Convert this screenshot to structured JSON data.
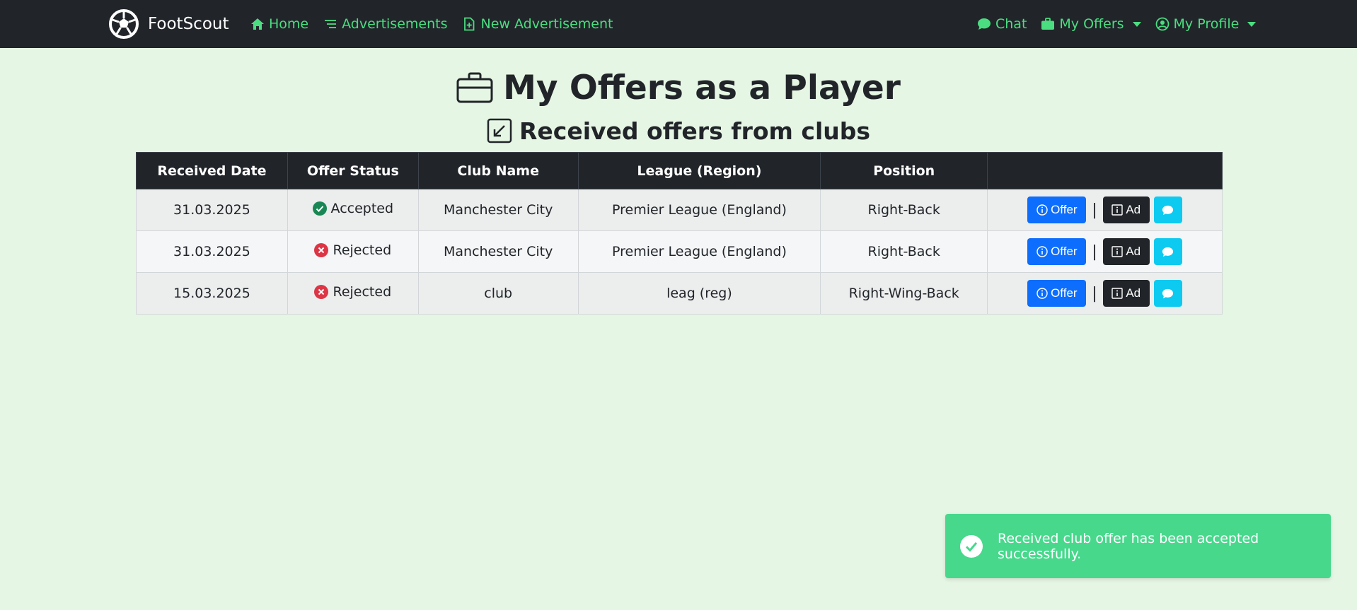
{
  "navbar": {
    "brand": "FootScout",
    "left_links": [
      {
        "label": "Home",
        "icon": "home-icon"
      },
      {
        "label": "Advertisements",
        "icon": "list-icon"
      },
      {
        "label": "New Advertisement",
        "icon": "file-plus-icon"
      }
    ],
    "right_links": [
      {
        "label": "Chat",
        "icon": "chat-icon"
      },
      {
        "label": "My Offers",
        "icon": "briefcase-icon",
        "dropdown": true
      },
      {
        "label": "My Profile",
        "icon": "person-circle-icon",
        "dropdown": true
      }
    ]
  },
  "page": {
    "title": "My Offers as a Player",
    "subtitle": "Received offers from clubs"
  },
  "table": {
    "headers": [
      "Received Date",
      "Offer Status",
      "Club Name",
      "League (Region)",
      "Position",
      ""
    ],
    "rows": [
      {
        "date": "31.03.2025",
        "status": "Accepted",
        "status_type": "accepted",
        "club": "Manchester City",
        "league": "Premier League (England)",
        "position": "Right-Back"
      },
      {
        "date": "31.03.2025",
        "status": "Rejected",
        "status_type": "rejected",
        "club": "Manchester City",
        "league": "Premier League (England)",
        "position": "Right-Back"
      },
      {
        "date": "15.03.2025",
        "status": "Rejected",
        "status_type": "rejected",
        "club": "club",
        "league": "leag (reg)",
        "position": "Right-Wing-Back"
      }
    ],
    "actions": {
      "offer_label": "Offer",
      "ad_label": "Ad",
      "separator": "|"
    }
  },
  "toast": {
    "message": "Received club offer has been accepted successfully."
  },
  "colors": {
    "navbar_bg": "#212529",
    "nav_link": "#4ade80",
    "page_bg": "#e6f6e4",
    "accepted": "#198754",
    "rejected": "#dc3545",
    "offer_button": "#0d6efd",
    "ad_button": "#212529",
    "chat_button": "#0dcaf0",
    "toast_bg": "#47d88c"
  }
}
